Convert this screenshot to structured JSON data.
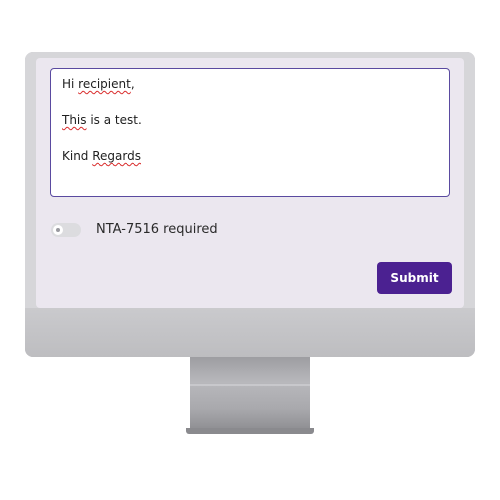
{
  "message": {
    "lines": [
      {
        "prefix": "Hi ",
        "flagged": "recipient",
        "suffix": ","
      },
      {
        "prefix": "",
        "flagged": "This",
        "suffix": " is a test."
      },
      {
        "prefix": "Kind ",
        "flagged": "Regards",
        "suffix": ""
      }
    ]
  },
  "toggle": {
    "label": "NTA-7516 required",
    "checked": false
  },
  "actions": {
    "submit_label": "Submit"
  },
  "colors": {
    "accent": "#4b2191",
    "field_border": "#5a4aa0",
    "screen_bg": "#ebe7ef",
    "spellcheck": "#d92c2c"
  }
}
